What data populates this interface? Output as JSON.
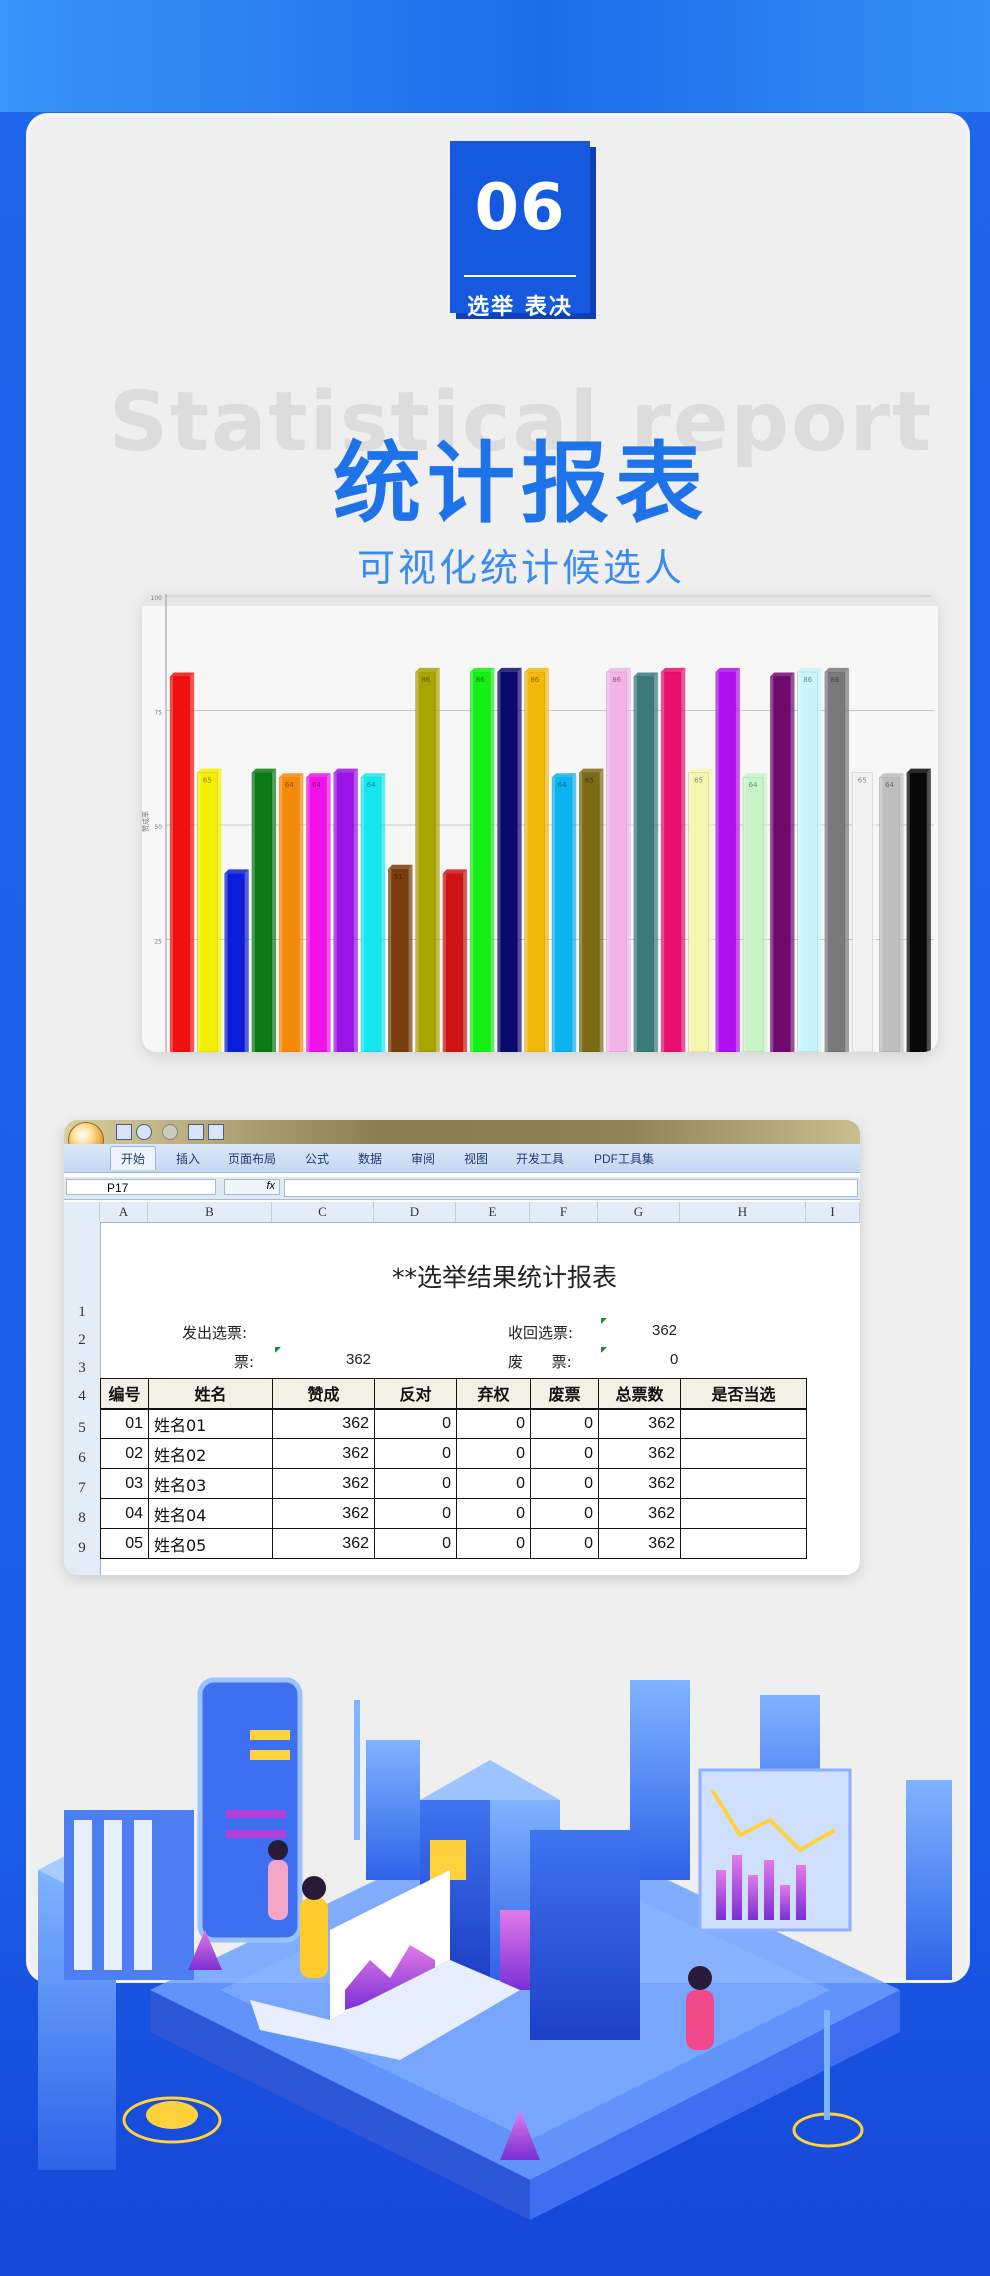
{
  "header": {
    "badge_number": "06",
    "badge_label": "选举 表决",
    "watermark": "Statistical report",
    "title": "统计报表",
    "subtitle": "可视化统计候选人"
  },
  "chart_data": {
    "type": "bar",
    "ylabel": "赞成率",
    "ylim": [
      0,
      100
    ],
    "yticks": [
      "100",
      "75",
      "50",
      "25"
    ],
    "grid": true,
    "bars": [
      {
        "value": 82,
        "label": "",
        "color": "#f01010"
      },
      {
        "value": 61,
        "label": "65",
        "color": "#f5f000"
      },
      {
        "value": 39,
        "label": "",
        "color": "#0a1ed8"
      },
      {
        "value": 61,
        "label": "",
        "color": "#0a7a14"
      },
      {
        "value": 60,
        "label": "64",
        "color": "#f58a0a"
      },
      {
        "value": 60,
        "label": "64",
        "color": "#f010e8"
      },
      {
        "value": 61,
        "label": "",
        "color": "#9a14e6"
      },
      {
        "value": 60,
        "label": "64",
        "color": "#14e8ee"
      },
      {
        "value": 40,
        "label": "51",
        "color": "#7a3c0a"
      },
      {
        "value": 83,
        "label": "86",
        "color": "#a8a400"
      },
      {
        "value": 39,
        "label": "",
        "color": "#d01414"
      },
      {
        "value": 83,
        "label": "86",
        "color": "#14f014"
      },
      {
        "value": 83,
        "label": "",
        "color": "#0a0a6e"
      },
      {
        "value": 83,
        "label": "86",
        "color": "#f2b80a"
      },
      {
        "value": 60,
        "label": "64",
        "color": "#0ab4f0"
      },
      {
        "value": 61,
        "label": "65",
        "color": "#7a6a14"
      },
      {
        "value": 83,
        "label": "86",
        "color": "#f2b4e8"
      },
      {
        "value": 82,
        "label": "",
        "color": "#3c7a7a"
      },
      {
        "value": 83,
        "label": "",
        "color": "#e8106e"
      },
      {
        "value": 61,
        "label": "65",
        "color": "#f5f5b0"
      },
      {
        "value": 83,
        "label": "",
        "color": "#b010f0"
      },
      {
        "value": 60,
        "label": "64",
        "color": "#c8f5c8"
      },
      {
        "value": 82,
        "label": "",
        "color": "#6e0a6e"
      },
      {
        "value": 83,
        "label": "86",
        "color": "#c8f5fa"
      },
      {
        "value": 83,
        "label": "86",
        "color": "#7a7a7a"
      },
      {
        "value": 61,
        "label": "65",
        "color": "#f2f2f2"
      },
      {
        "value": 60,
        "label": "64",
        "color": "#bebebe"
      },
      {
        "value": 61,
        "label": "",
        "color": "#080808"
      }
    ]
  },
  "excel": {
    "ribbon_tabs": [
      "开始",
      "插入",
      "页面布局",
      "公式",
      "数据",
      "审阅",
      "视图",
      "开发工具",
      "PDF工具集"
    ],
    "name_box": "P17",
    "fx": "fx",
    "columns": [
      "A",
      "B",
      "C",
      "D",
      "E",
      "F",
      "G",
      "H",
      "I"
    ],
    "rows": [
      "1",
      "2",
      "3",
      "4",
      "5",
      "6",
      "7",
      "8",
      "9"
    ],
    "sheet_title": "**选举结果统计报表",
    "issued_label": "发出选票:",
    "issued_value": "",
    "recovered_label": "收回选票:",
    "recovered_value": "362",
    "valid_label": "票:",
    "valid_value": "362",
    "invalid_label": "废      票:",
    "invalid_value": "0",
    "table_headers": [
      "编号",
      "姓名",
      "赞成",
      "反对",
      "弃权",
      "废票",
      "总票数",
      "是否当选"
    ],
    "table_rows": [
      [
        "01",
        "姓名01",
        "362",
        "0",
        "0",
        "0",
        "362",
        ""
      ],
      [
        "02",
        "姓名02",
        "362",
        "0",
        "0",
        "0",
        "362",
        ""
      ],
      [
        "03",
        "姓名03",
        "362",
        "0",
        "0",
        "0",
        "362",
        ""
      ],
      [
        "04",
        "姓名04",
        "362",
        "0",
        "0",
        "0",
        "362",
        ""
      ],
      [
        "05",
        "姓名05",
        "362",
        "0",
        "0",
        "0",
        "362",
        ""
      ]
    ]
  },
  "colors": {
    "brand_blue": "#1f73e8",
    "card_bg": "#efefef",
    "badge_bg": "#1559de"
  }
}
